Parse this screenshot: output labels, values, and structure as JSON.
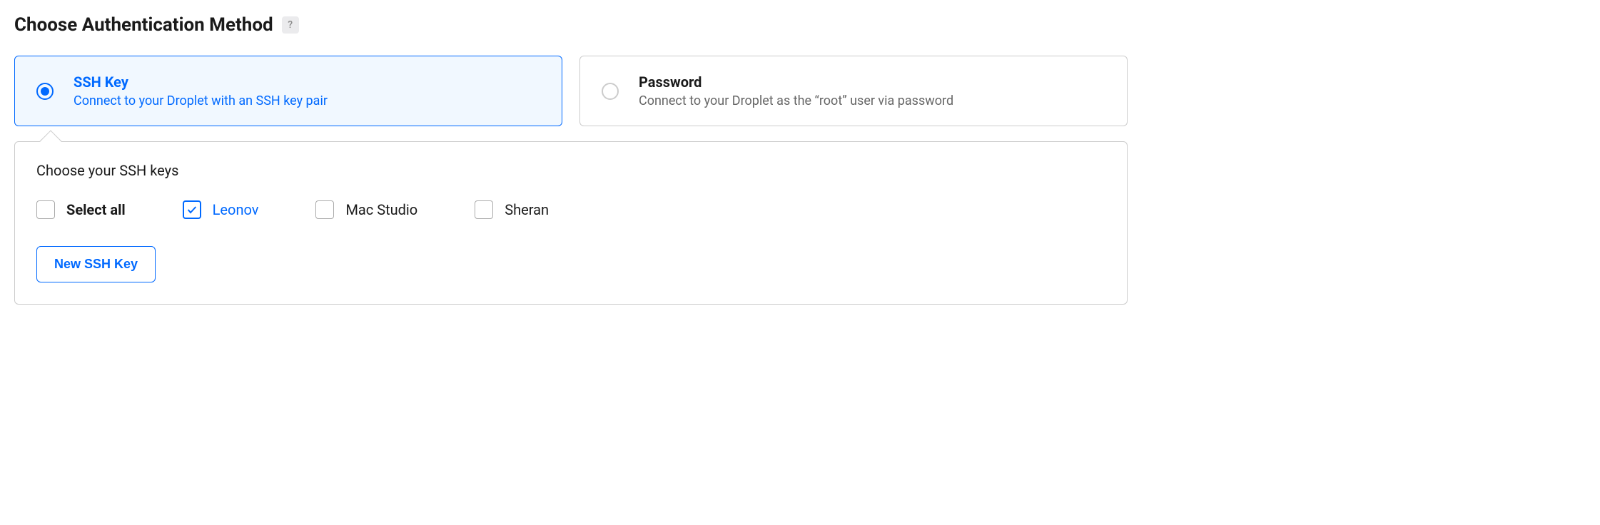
{
  "section": {
    "title": "Choose Authentication Method",
    "help_icon": "?"
  },
  "auth_methods": {
    "ssh": {
      "title": "SSH Key",
      "description": "Connect to your Droplet with an SSH key pair",
      "selected": true
    },
    "password": {
      "title": "Password",
      "description": "Connect to your Droplet as the “root” user via password",
      "selected": false
    }
  },
  "ssh_panel": {
    "title": "Choose your SSH keys",
    "select_all_label": "Select all",
    "keys": [
      {
        "name": "Leonov",
        "checked": true
      },
      {
        "name": "Mac Studio",
        "checked": false
      },
      {
        "name": "Sheran",
        "checked": false
      }
    ],
    "new_key_button": "New SSH Key"
  }
}
